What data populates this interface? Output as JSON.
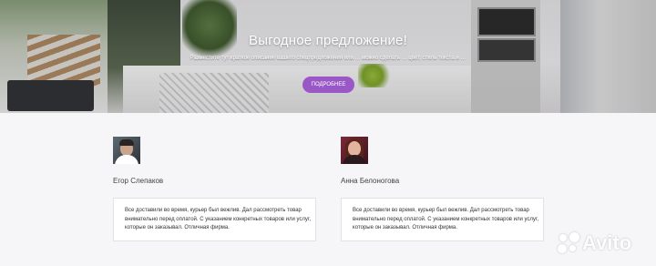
{
  "hero": {
    "title": "Выгодное предложение!",
    "description": "Разместите тут краткое описание вашего спецпредложения или … можно сделать … цвет, стиль текста и …",
    "button_label": "ПОДРОБНЕЕ"
  },
  "testimonials": [
    {
      "name": "Егор Слепаков",
      "text": "Все доставили во время, курьер был вежлив. Дал рассмотреть товар внимательно перед оплатой. С указанием конкретных товаров или услуг, которые он заказывал. Отличная фирма."
    },
    {
      "name": "Анна Белоногова",
      "text": "Все доставили во время, курьер был вежлив. Дал рассмотреть товар внимательно перед оплатой. С указанием конкретных товаров или услуг, которые он заказывал. Отличная фирма."
    }
  ],
  "watermark": {
    "text": "Avito"
  },
  "colors": {
    "accent": "#9a57c6",
    "background": "#f6f5f7",
    "card_border": "#e2e2e2"
  }
}
